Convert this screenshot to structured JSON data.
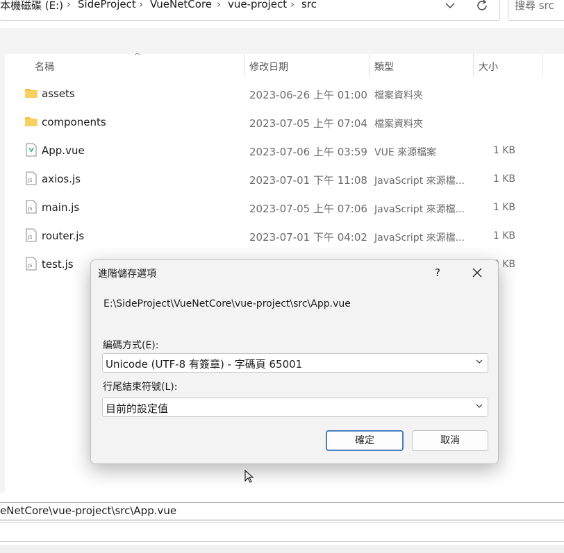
{
  "address": {
    "crumbs": [
      "本機磁碟 (E:)",
      "SideProject",
      "VueNetCore",
      "vue-project",
      "src"
    ],
    "separator": "›",
    "dropdown_icon": "chevron-down-icon",
    "refresh_icon": "refresh-icon"
  },
  "search": {
    "placeholder": "搜尋 src"
  },
  "columns": {
    "name": "名稱",
    "date": "修改日期",
    "type": "類型",
    "size": "大小",
    "sort_indicator": "^"
  },
  "files": [
    {
      "name": "assets",
      "date": "2023-06-26 上午 01:00",
      "type": "檔案資料夾",
      "size": "",
      "icon": "folder-icon"
    },
    {
      "name": "components",
      "date": "2023-07-05 上午 07:04",
      "type": "檔案資料夾",
      "size": "",
      "icon": "folder-icon"
    },
    {
      "name": "App.vue",
      "date": "2023-07-06 上午 03:59",
      "type": "VUE 來源檔案",
      "size": "1 KB",
      "icon": "vue-file-icon"
    },
    {
      "name": "axios.js",
      "date": "2023-07-01 下午 11:08",
      "type": "JavaScript 來源檔...",
      "size": "1 KB",
      "icon": "js-file-icon"
    },
    {
      "name": "main.js",
      "date": "2023-07-05 上午 07:06",
      "type": "JavaScript 來源檔...",
      "size": "1 KB",
      "icon": "js-file-icon"
    },
    {
      "name": "router.js",
      "date": "2023-07-01 下午 04:02",
      "type": "JavaScript 來源檔...",
      "size": "1 KB",
      "icon": "js-file-icon"
    },
    {
      "name": "test.js",
      "date": "",
      "type": "",
      "size": "0 KB",
      "icon": "js-file-icon"
    }
  ],
  "dialog": {
    "title": "進階儲存選項",
    "help": "?",
    "close": "✕",
    "path": "E:\\SideProject\\VueNetCore\\vue-project\\src\\App.vue",
    "encoding_label": "編碼方式(E):",
    "encoding_value": "Unicode (UTF-8 有簽章) - 字碼頁 65001",
    "lineending_label": "行尾結束符號(L):",
    "lineending_value": "目前的設定值",
    "ok": "確定",
    "cancel": "取消"
  },
  "filename_field": {
    "value": "eNetCore\\vue-project\\src\\App.vue"
  },
  "colors": {
    "accent": "#4a7fc0",
    "folder": "#f5c542",
    "vue": "#41b883"
  }
}
